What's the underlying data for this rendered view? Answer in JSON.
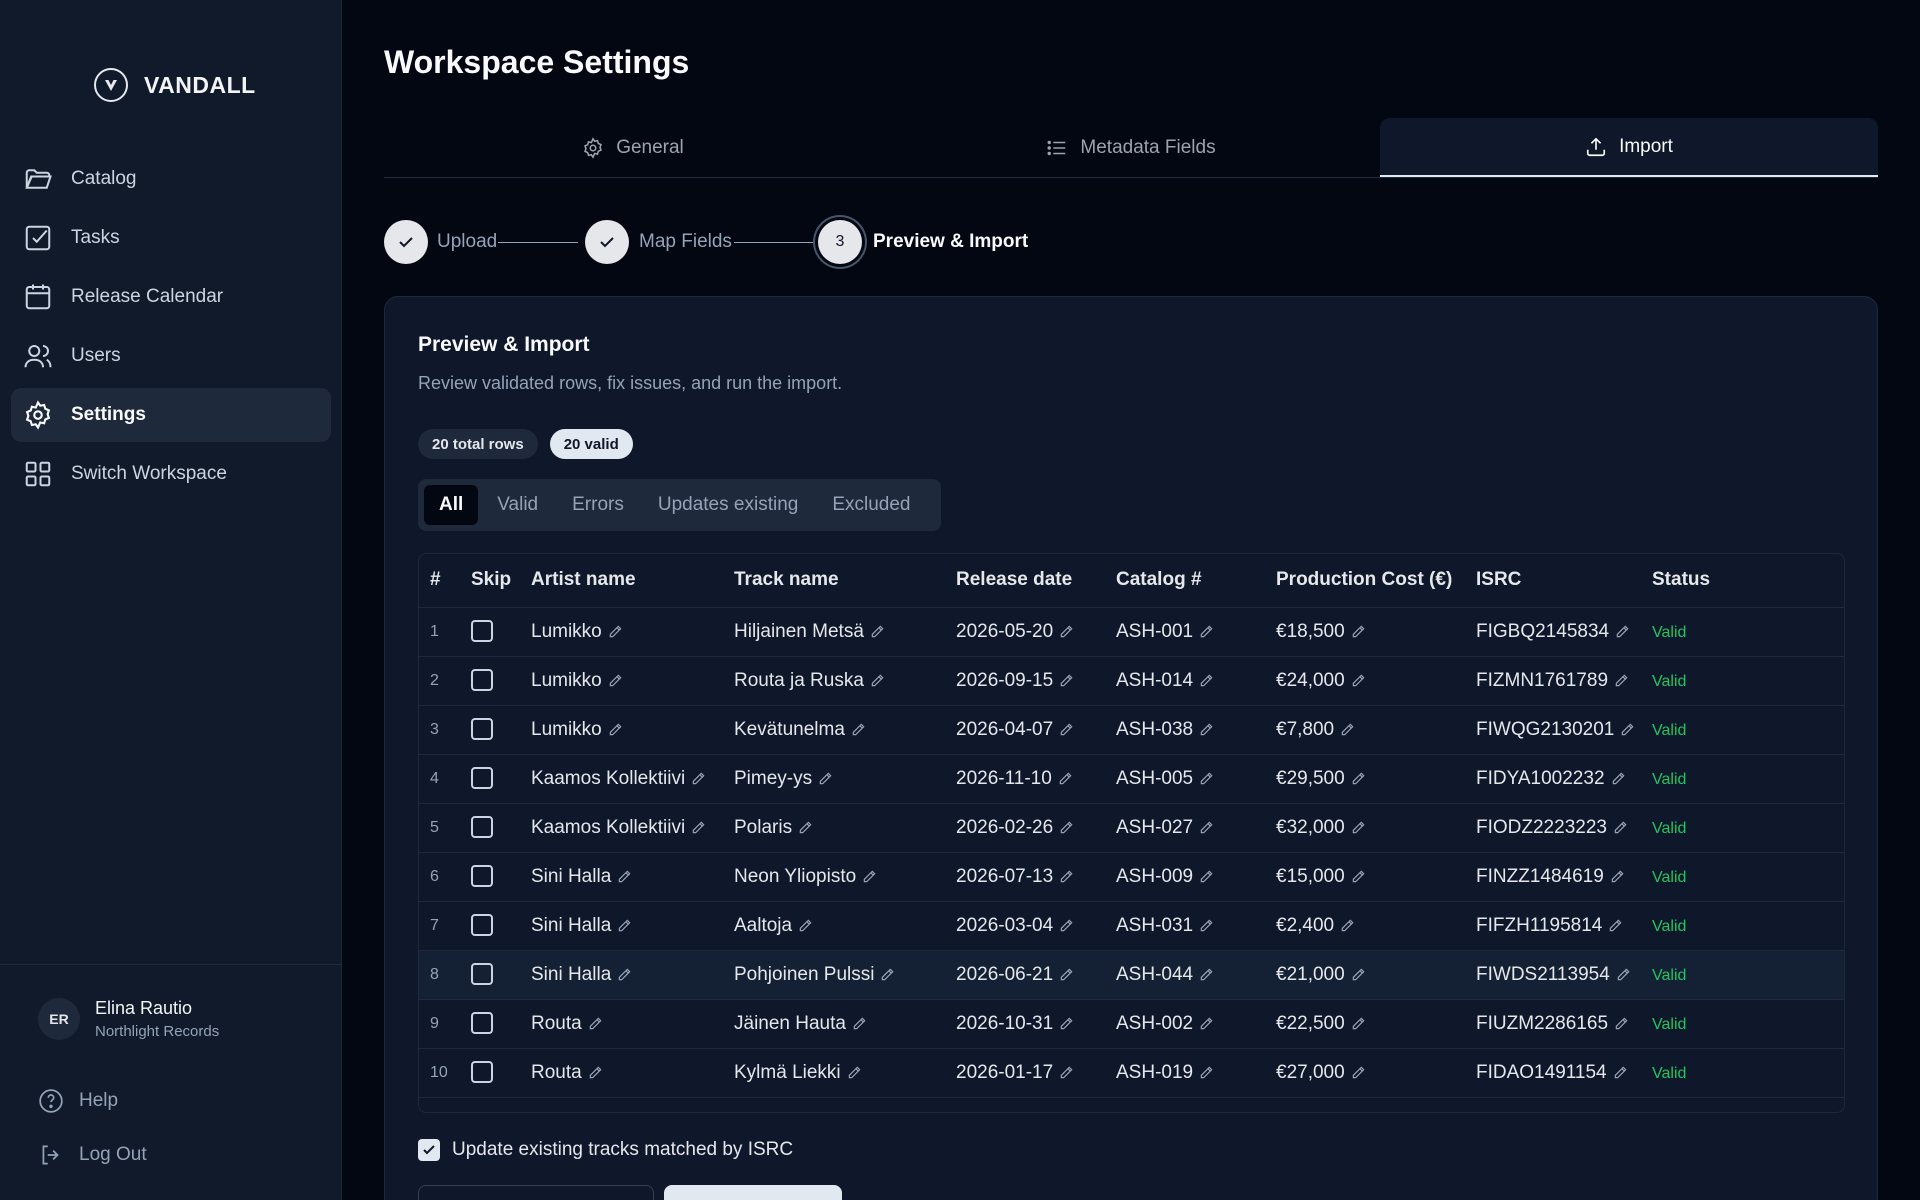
{
  "brand": {
    "name": "VANDALL"
  },
  "sidebar": {
    "items": [
      {
        "label": "Catalog",
        "icon": "folder-icon"
      },
      {
        "label": "Tasks",
        "icon": "checkbox-icon"
      },
      {
        "label": "Release Calendar",
        "icon": "calendar-icon"
      },
      {
        "label": "Users",
        "icon": "users-icon"
      },
      {
        "label": "Settings",
        "icon": "gear-icon",
        "active": true
      },
      {
        "label": "Switch Workspace",
        "icon": "grid-icon"
      }
    ],
    "user": {
      "initials": "ER",
      "name": "Elina Rautio",
      "org": "Northlight Records"
    },
    "help_label": "Help",
    "logout_label": "Log Out"
  },
  "page": {
    "title": "Workspace Settings"
  },
  "tabs": [
    {
      "label": "General",
      "icon": "gear-icon"
    },
    {
      "label": "Metadata Fields",
      "icon": "list-icon"
    },
    {
      "label": "Import",
      "icon": "upload-icon",
      "active": true
    }
  ],
  "stepper": {
    "steps": [
      {
        "label": "Upload",
        "state": "done"
      },
      {
        "label": "Map Fields",
        "state": "done"
      },
      {
        "label": "Preview & Import",
        "state": "current",
        "number": "3"
      }
    ]
  },
  "card": {
    "title": "Preview & Import",
    "subtitle": "Review validated rows, fix issues, and run the import.",
    "badges": {
      "total": "20 total rows",
      "valid": "20 valid"
    },
    "filters": [
      "All",
      "Valid",
      "Errors",
      "Updates existing",
      "Excluded"
    ],
    "active_filter": "All",
    "update_existing_label": "Update existing tracks matched by ISRC",
    "update_existing_checked": true
  },
  "table": {
    "columns": [
      "#",
      "Skip",
      "Artist name",
      "Track name",
      "Release date",
      "Catalog #",
      "Production Cost (€)",
      "ISRC",
      "Status"
    ],
    "rows": [
      {
        "n": "1",
        "artist": "Lumikko",
        "track": "Hiljainen Metsä",
        "date": "2026-05-20",
        "catalog": "ASH-001",
        "cost": "€18,500",
        "isrc": "FIGBQ2145834",
        "status": "Valid"
      },
      {
        "n": "2",
        "artist": "Lumikko",
        "track": "Routa ja Ruska",
        "date": "2026-09-15",
        "catalog": "ASH-014",
        "cost": "€24,000",
        "isrc": "FIZMN1761789",
        "status": "Valid"
      },
      {
        "n": "3",
        "artist": "Lumikko",
        "track": "Kevätunelma",
        "date": "2026-04-07",
        "catalog": "ASH-038",
        "cost": "€7,800",
        "isrc": "FIWQG2130201",
        "status": "Valid"
      },
      {
        "n": "4",
        "artist": "Kaamos Kollektiivi",
        "track": "Pimey-ys",
        "date": "2026-11-10",
        "catalog": "ASH-005",
        "cost": "€29,500",
        "isrc": "FIDYA1002232",
        "status": "Valid"
      },
      {
        "n": "5",
        "artist": "Kaamos Kollektiivi",
        "track": "Polaris",
        "date": "2026-02-26",
        "catalog": "ASH-027",
        "cost": "€32,000",
        "isrc": "FIODZ2223223",
        "status": "Valid"
      },
      {
        "n": "6",
        "artist": "Sini Halla",
        "track": "Neon Yliopisto",
        "date": "2026-07-13",
        "catalog": "ASH-009",
        "cost": "€15,000",
        "isrc": "FINZZ1484619",
        "status": "Valid"
      },
      {
        "n": "7",
        "artist": "Sini Halla",
        "track": "Aaltoja",
        "date": "2026-03-04",
        "catalog": "ASH-031",
        "cost": "€2,400",
        "isrc": "FIFZH1195814",
        "status": "Valid"
      },
      {
        "n": "8",
        "artist": "Sini Halla",
        "track": "Pohjoinen Pulssi",
        "date": "2026-06-21",
        "catalog": "ASH-044",
        "cost": "€21,000",
        "isrc": "FIWDS2113954",
        "status": "Valid",
        "highlight": true
      },
      {
        "n": "9",
        "artist": "Routa",
        "track": "Jäinen Hauta",
        "date": "2026-10-31",
        "catalog": "ASH-002",
        "cost": "€22,500",
        "isrc": "FIUZM2286165",
        "status": "Valid"
      },
      {
        "n": "10",
        "artist": "Routa",
        "track": "Kylmä Liekki",
        "date": "2026-01-17",
        "catalog": "ASH-019",
        "cost": "€27,000",
        "isrc": "FIDAO1491154",
        "status": "Valid"
      }
    ]
  },
  "colors": {
    "background": "#030712",
    "sidebar": "#101a2b",
    "valid": "#22c55e"
  }
}
